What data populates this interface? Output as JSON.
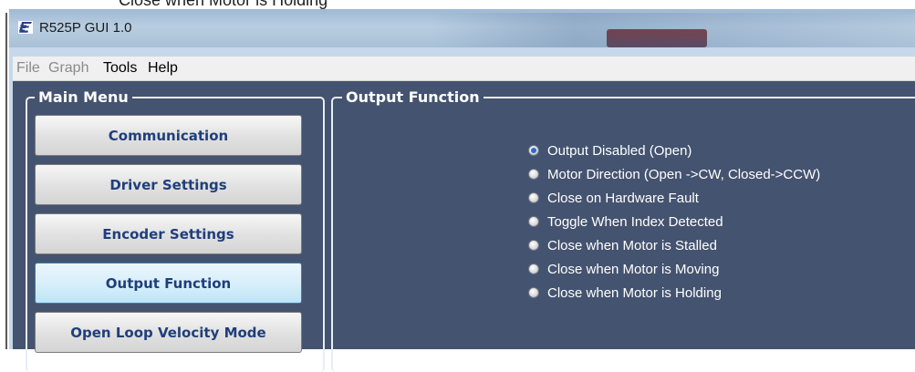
{
  "document": {
    "caption": "Close when Motor is Holding"
  },
  "window": {
    "title": "R525P GUI 1.0",
    "app_icon": "r525p-logo-icon"
  },
  "menubar": {
    "items": [
      {
        "label": "File",
        "enabled": false
      },
      {
        "label": "Graph",
        "enabled": false
      },
      {
        "label": "Tools",
        "enabled": true
      },
      {
        "label": "Help",
        "enabled": true
      }
    ]
  },
  "main_menu": {
    "title": "Main Menu",
    "buttons": [
      {
        "label": "Communication",
        "active": false
      },
      {
        "label": "Driver Settings",
        "active": false
      },
      {
        "label": "Encoder Settings",
        "active": false
      },
      {
        "label": "Output Function",
        "active": true
      },
      {
        "label": "Open Loop Velocity Mode",
        "active": false
      }
    ]
  },
  "output_function": {
    "title": "Output Function",
    "selected_index": 0,
    "options": [
      "Output Disabled (Open)",
      "Motor Direction (Open ->CW, Closed->CCW)",
      "Close on Hardware Fault",
      "Toggle When Index Detected",
      "Close when Motor is Stalled",
      "Close when Motor is Moving",
      "Close when Motor is Holding"
    ]
  },
  "colors": {
    "panel_background": "#44536f",
    "button_text": "#1f3f7a",
    "menubar_background": "#f0f0f0"
  }
}
